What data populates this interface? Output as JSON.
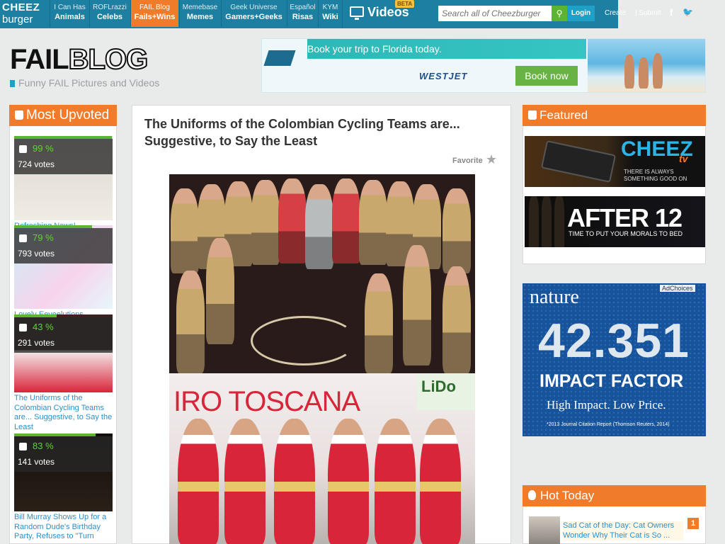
{
  "topnav": {
    "logo_line1": "CHEEZ",
    "logo_line2": "burger",
    "items": [
      {
        "small": "I Can Has",
        "large": "Animals"
      },
      {
        "small": "ROFLrazzi",
        "large": "Celebs"
      },
      {
        "small": "FAIL Blog",
        "large": "Fails+Wins"
      },
      {
        "small": "Memebase",
        "large": "Memes"
      },
      {
        "small": "Geek Universe",
        "large": "Gamers+Geeks"
      },
      {
        "small": "Español",
        "large": "Risas"
      },
      {
        "small": "KYM",
        "large": "Wiki"
      }
    ],
    "videos_label": "Videos",
    "videos_badge": "BETA",
    "search_placeholder": "Search all of Cheezburger",
    "search_icon": "magnifier-icon",
    "login_label": "Login",
    "create_label": "Create",
    "submit_label": "| Submit",
    "facebook_glyph": "f",
    "twitter_glyph": "🐦"
  },
  "header": {
    "logo_fail": "FAIL",
    "logo_blog": "BLOG",
    "tagline": "Funny FAIL Pictures and Videos"
  },
  "ad_banner": {
    "headline": "Book your trip to Florida today.",
    "brand": "WESTJET",
    "cta": "Book now"
  },
  "most_upvoted": {
    "heading": "Most Upvoted",
    "items": [
      {
        "percent": "99 %",
        "votes": "724 votes",
        "title": "Refreshing News!"
      },
      {
        "percent": "79 %",
        "votes": "793 votes",
        "title": "Lovely Eeveelutions"
      },
      {
        "percent": "43 %",
        "votes": "291 votes",
        "title": "The Uniforms of the Colombian Cycling Teams are... Suggestive, to Say the Least"
      },
      {
        "percent": "83 %",
        "votes": "141 votes",
        "title": "Bill Murray Shows Up for a Random Dude's Birthday Party, Refuses to \"Turn"
      }
    ]
  },
  "post": {
    "title": "The Uniforms of the Colombian Cycling Teams are... Suggestive, to Say the Least",
    "favorite_label": "Favorite",
    "star_glyph": "★",
    "photo2_text": "IRO TOSCANA",
    "photo2_sponsor": "LiDo"
  },
  "featured": {
    "heading": "Featured",
    "cheez_brand": "CHEEZ",
    "cheez_tv": "tv",
    "cheez_sub": "THERE IS ALWAYS SOMETHING GOOD ON",
    "after_title": "AFTER 12",
    "after_sub": "TIME TO PUT YOUR MORALS TO BED"
  },
  "nature_ad": {
    "brand": "nature",
    "adchoices": "AdChoices",
    "number": "42.351",
    "label": "IMPACT FACTOR",
    "tagline": "High Impact. Low Price.",
    "citation": "*2013 Journal Citation Report (Thomson Reuters, 2014)"
  },
  "hot_today": {
    "heading": "Hot Today",
    "items": [
      {
        "rank": "1",
        "title": "Sad Cat of the Day: Cat Owners Wonder Why Their Cat is So ..."
      }
    ]
  },
  "colors": {
    "nav_blue": "#1d7fa1",
    "accent_orange": "#f07c2b",
    "upvote_green": "#5bb531",
    "link_blue": "#2a8fcc"
  }
}
